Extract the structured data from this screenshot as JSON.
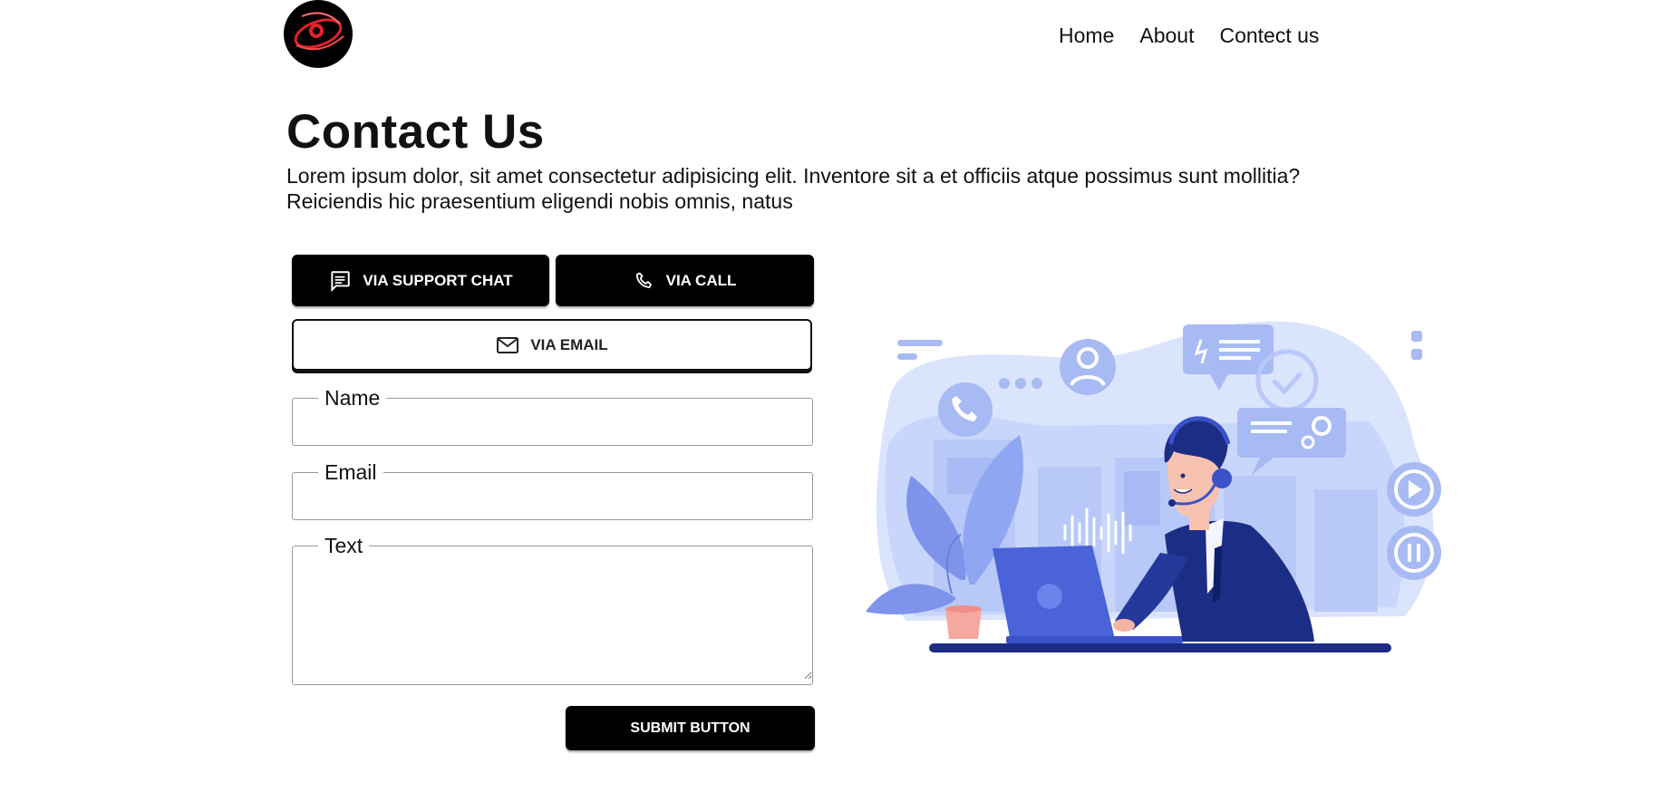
{
  "header": {
    "nav": [
      "Home",
      "About",
      "Contect us"
    ]
  },
  "intro": {
    "title": "Contact Us",
    "description": "Lorem ipsum dolor, sit amet consectetur adipisicing elit. Inventore sit a et officiis atque possimus sunt mollitia? Reiciendis hic praesentium eligendi nobis omnis, natus"
  },
  "contact_methods": {
    "chat": {
      "label": "VIA SUPPORT CHAT",
      "icon": "chat-icon"
    },
    "call": {
      "label": "VIA CALL",
      "icon": "phone-icon"
    },
    "email": {
      "label": "VIA EMAIL",
      "icon": "mail-icon"
    }
  },
  "form": {
    "name_label": "Name",
    "name_value": "",
    "email_label": "Email",
    "email_value": "",
    "text_label": "Text",
    "text_value": "",
    "submit_label": "SUBMIT BUTTON"
  },
  "colors": {
    "primary": "#000000",
    "illustration_light": "#dbe4fd",
    "illustration_mid": "#8fa6f2",
    "illustration_dark": "#1b2d85"
  }
}
